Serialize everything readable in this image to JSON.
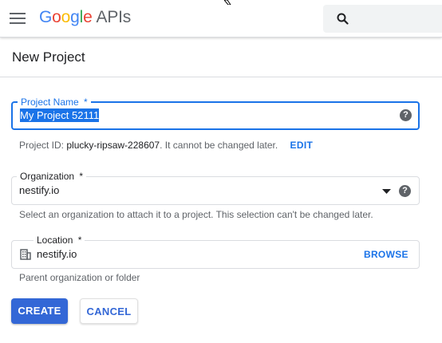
{
  "header": {
    "logo_google": [
      "G",
      "o",
      "o",
      "g",
      "l",
      "e"
    ],
    "logo_apis": "APIs",
    "menu_icon": "hamburger-menu-icon",
    "search_icon": "search-icon"
  },
  "page": {
    "title": "New Project"
  },
  "form": {
    "project_name": {
      "label": "Project Name",
      "required_mark": "*",
      "value": "My Project 52111",
      "help_icon": "?"
    },
    "project_id": {
      "prefix": "Project ID:",
      "id": "plucky-ripsaw-228607",
      "suffix": ". It cannot be changed later.",
      "edit_label": "EDIT"
    },
    "organization": {
      "label": "Organization",
      "required_mark": "*",
      "value": "nestify.io",
      "help_icon": "?",
      "hint": "Select an organization to attach it to a project. This selection can't be changed later."
    },
    "location": {
      "label": "Location",
      "required_mark": "*",
      "value": "nestify.io",
      "browse_label": "BROWSE",
      "hint": "Parent organization or folder"
    }
  },
  "actions": {
    "create_label": "CREATE",
    "cancel_label": "CANCEL"
  },
  "colors": {
    "accent": "#1a73e8",
    "button_primary": "#3367d6"
  }
}
